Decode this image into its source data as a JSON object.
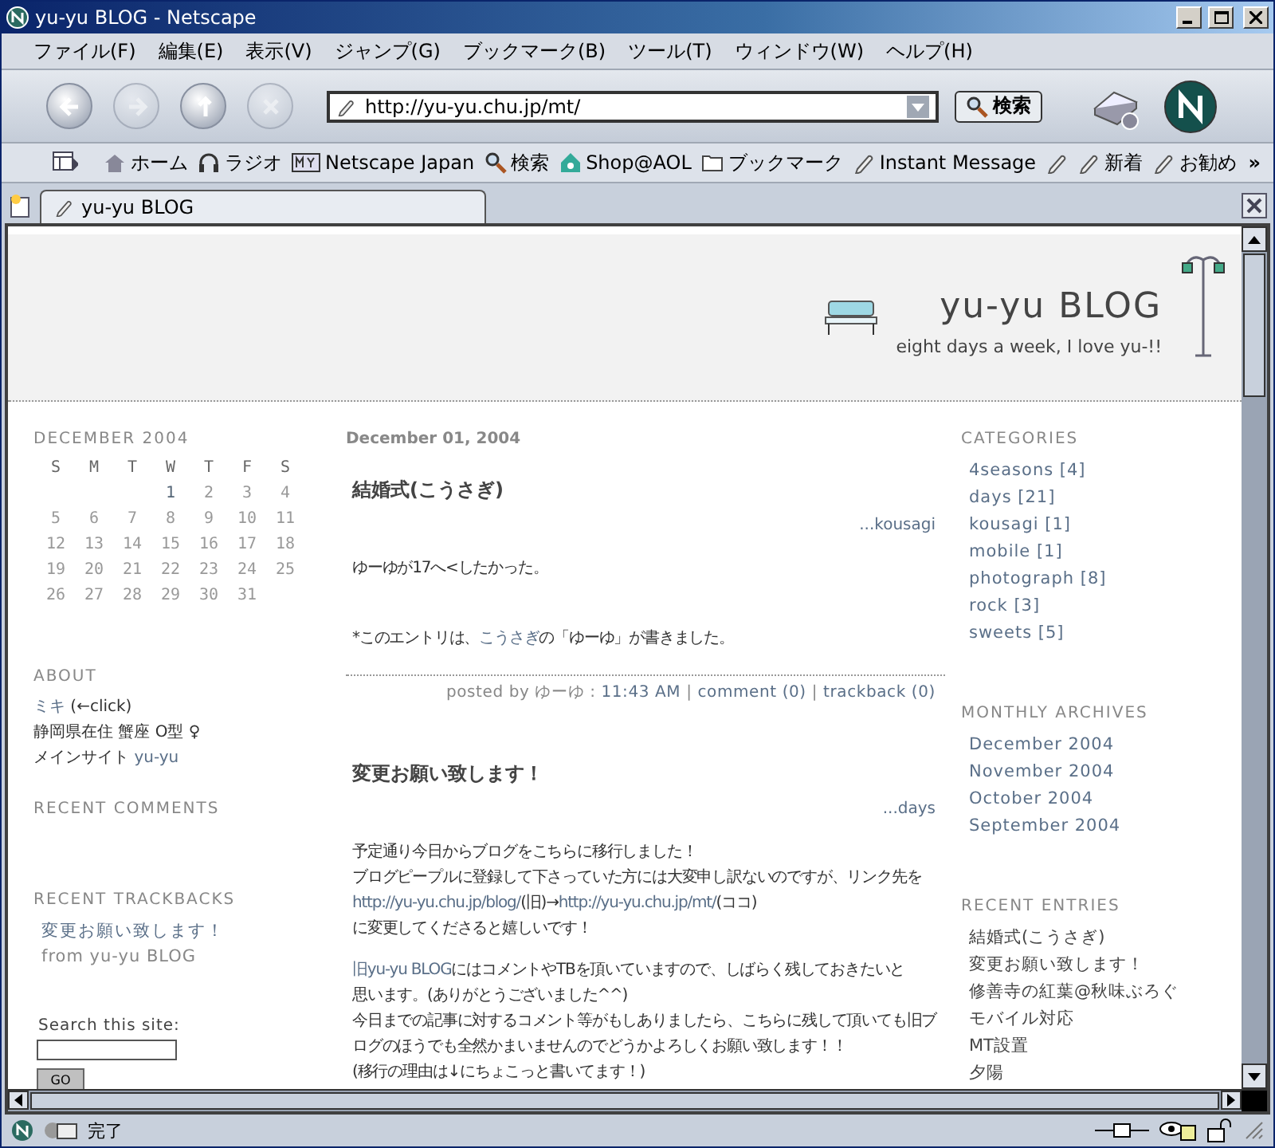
{
  "window": {
    "title": "yu-yu BLOG - Netscape"
  },
  "menu": [
    "ファイル(F)",
    "編集(E)",
    "表示(V)",
    "ジャンプ(G)",
    "ブックマーク(B)",
    "ツール(T)",
    "ウィンドウ(W)",
    "ヘルプ(H)"
  ],
  "nav_buttons": [
    {
      "kind": "back",
      "disabled": false
    },
    {
      "kind": "forward",
      "disabled": true
    },
    {
      "kind": "reload",
      "disabled": false
    },
    {
      "kind": "stop",
      "disabled": true
    }
  ],
  "address": {
    "value": "http://yu-yu.chu.jp/mt/"
  },
  "search_button": "検索",
  "personal_toolbar": [
    {
      "kind": "home",
      "label": "ホーム"
    },
    {
      "kind": "radio",
      "label": "ラジオ"
    },
    {
      "kind": "portal",
      "label": "Netscape Japan"
    },
    {
      "kind": "search",
      "label": "検索"
    },
    {
      "kind": "shop",
      "label": "Shop@AOL"
    },
    {
      "kind": "folder",
      "label": "ブックマーク"
    },
    {
      "kind": "bookmark",
      "label": "Instant Message"
    },
    {
      "kind": "bookmark"
    },
    {
      "kind": "bookmark",
      "label": "新着"
    },
    {
      "kind": "bookmark",
      "label": "お勧め"
    }
  ],
  "overflow": "»",
  "tab": {
    "label": "yu-yu BLOG",
    "selected": true
  },
  "blog": {
    "title": "yu-yu BLOG",
    "tagline": "eight days a week, I love yu-!!"
  },
  "calendar": {
    "month": "DECEMBER 2004",
    "weekdays": [
      "S",
      "M",
      "T",
      "W",
      "T",
      "F",
      "S"
    ],
    "weeks": [
      [
        {
          "kind": "blank"
        },
        {
          "kind": "blank"
        },
        {
          "kind": "blank"
        },
        {
          "kind": "day",
          "d": "1",
          "linked": true
        },
        {
          "kind": "day",
          "d": "2",
          "linked": false
        },
        {
          "kind": "day",
          "d": "3",
          "linked": false
        },
        {
          "kind": "day",
          "d": "4",
          "linked": false
        }
      ],
      [
        {
          "kind": "day",
          "d": "5",
          "linked": false
        },
        {
          "kind": "day",
          "d": "6",
          "linked": false
        },
        {
          "kind": "day",
          "d": "7",
          "linked": false
        },
        {
          "kind": "day",
          "d": "8",
          "linked": false
        },
        {
          "kind": "day",
          "d": "9",
          "linked": false
        },
        {
          "kind": "day",
          "d": "10",
          "linked": false
        },
        {
          "kind": "day",
          "d": "11",
          "linked": false
        }
      ],
      [
        {
          "kind": "day",
          "d": "12",
          "linked": false
        },
        {
          "kind": "day",
          "d": "13",
          "linked": false
        },
        {
          "kind": "day",
          "d": "14",
          "linked": false
        },
        {
          "kind": "day",
          "d": "15",
          "linked": false
        },
        {
          "kind": "day",
          "d": "16",
          "linked": false
        },
        {
          "kind": "day",
          "d": "17",
          "linked": false
        },
        {
          "kind": "day",
          "d": "18",
          "linked": false
        }
      ],
      [
        {
          "kind": "day",
          "d": "19",
          "linked": false
        },
        {
          "kind": "day",
          "d": "20",
          "linked": false
        },
        {
          "kind": "day",
          "d": "21",
          "linked": false
        },
        {
          "kind": "day",
          "d": "22",
          "linked": false
        },
        {
          "kind": "day",
          "d": "23",
          "linked": false
        },
        {
          "kind": "day",
          "d": "24",
          "linked": false
        },
        {
          "kind": "day",
          "d": "25",
          "linked": false
        }
      ],
      [
        {
          "kind": "day",
          "d": "26",
          "linked": false
        },
        {
          "kind": "day",
          "d": "27",
          "linked": false
        },
        {
          "kind": "day",
          "d": "28",
          "linked": false
        },
        {
          "kind": "day",
          "d": "29",
          "linked": false
        },
        {
          "kind": "day",
          "d": "30",
          "linked": false
        },
        {
          "kind": "day",
          "d": "31",
          "linked": false
        },
        {
          "kind": "blank"
        }
      ]
    ]
  },
  "about": {
    "heading": "ABOUT",
    "lines": [
      [
        {
          "text": "ミキ",
          "link": true
        },
        {
          "text": " (←click)",
          "link": false
        }
      ],
      [
        {
          "text": "静岡県在住 蟹座 O型 ♀",
          "link": false
        }
      ],
      [
        {
          "text": "メインサイト ",
          "link": false
        },
        {
          "text": "yu-yu",
          "link": true
        }
      ]
    ]
  },
  "recent_comments": {
    "heading": "RECENT COMMENTS"
  },
  "recent_trackbacks": {
    "heading": "RECENT TRACKBACKS",
    "items": [
      {
        "title": "変更お願い致します！",
        "from": "from yu-yu BLOG"
      }
    ]
  },
  "search": {
    "label": "Search this site:",
    "button": "GO"
  },
  "posts": [
    {
      "date": "December 01, 2004",
      "title": "結婚式(こうさぎ)",
      "category": "...kousagi",
      "paragraphs": [
        [
          [
            {
              "text": "ゆーゆが17へ<したかった。",
              "link": false
            }
          ]
        ],
        [
          [
            {
              "text": "*このエントリは、",
              "link": false
            },
            {
              "text": "こうさぎ",
              "link": true
            },
            {
              "text": "の「ゆーゆ」が書きました。",
              "link": false
            }
          ]
        ]
      ],
      "footer": [
        {
          "text": "posted by ゆーゆ : ",
          "link": false
        },
        {
          "text": "11:43 AM",
          "link": true
        },
        {
          "text": " | ",
          "link": false
        },
        {
          "text": "comment (0)",
          "link": true
        },
        {
          "text": " | ",
          "link": false
        },
        {
          "text": "trackback (0)",
          "link": true
        }
      ]
    },
    {
      "title": "変更お願い致します！",
      "category": "...days",
      "paragraphs": [
        [
          [
            {
              "text": "予定通り今日からブログをこちらに移行しました！",
              "link": false
            }
          ],
          [
            {
              "text": "ブログピープルに登録して下さっていた方には大変申し訳ないのですが、リンク先を",
              "link": false
            }
          ],
          [
            {
              "text": "http://yu-yu.chu.jp/blog/",
              "link": true
            },
            {
              "text": "(旧)→",
              "link": false
            },
            {
              "text": "http://yu-yu.chu.jp/mt/",
              "link": true
            },
            {
              "text": "(ココ)",
              "link": false
            }
          ],
          [
            {
              "text": "に変更してくださると嬉しいです！",
              "link": false
            }
          ]
        ],
        [
          [
            {
              "text": "旧yu-yu BLOG",
              "link": true
            },
            {
              "text": "にはコメントやTBを頂いていますので、しばらく残しておきたいと",
              "link": false
            }
          ],
          [
            {
              "text": "思います。(ありがとうございました^^)",
              "link": false
            }
          ],
          [
            {
              "text": "今日までの記事に対するコメント等がもしありましたら、こちらに残して頂いても旧ブ",
              "link": false
            }
          ],
          [
            {
              "text": "ログのほうでも全然かまいませんのでどうかよろしくお願い致します！！",
              "link": false
            }
          ],
          [
            {
              "text": "(移行の理由は↓にちょこっと書いてます！)",
              "link": false
            }
          ]
        ]
      ]
    }
  ],
  "categories": {
    "heading": "CATEGORIES",
    "items": [
      "4seasons [4]",
      "days [21]",
      "kousagi [1]",
      "mobile [1]",
      "photograph [8]",
      "rock [3]",
      "sweets [5]"
    ]
  },
  "archives": {
    "heading": "MONTHLY ARCHIVES",
    "items": [
      "December 2004",
      "November 2004",
      "October 2004",
      "September 2004"
    ]
  },
  "recent_entries": {
    "heading": "RECENT ENTRIES",
    "items": [
      "結婚式(こうさぎ)",
      "変更お願い致します！",
      "修善寺の紅葉@秋味ぶろぐ",
      "モバイル対応",
      "MT設置",
      "夕陽"
    ]
  },
  "status": {
    "text": "完了"
  }
}
